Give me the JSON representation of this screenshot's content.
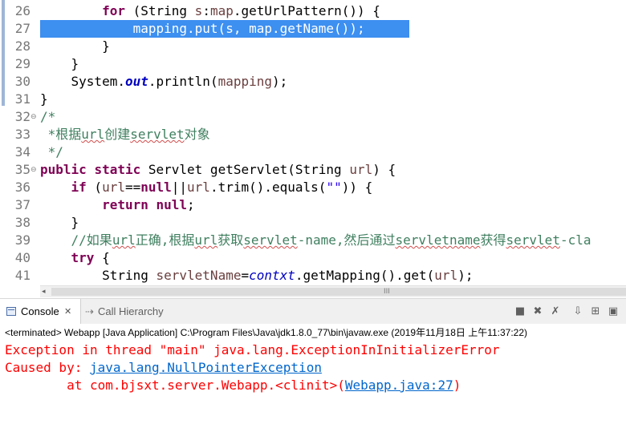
{
  "editor": {
    "lines": [
      {
        "num": "26",
        "fold": false,
        "highlight": false,
        "selected": false,
        "tokens": [
          {
            "t": "        ",
            "c": ""
          },
          {
            "t": "for",
            "c": "kw"
          },
          {
            "t": " (String ",
            "c": ""
          },
          {
            "t": "s",
            "c": "var"
          },
          {
            "t": ":",
            "c": ""
          },
          {
            "t": "map",
            "c": "var"
          },
          {
            "t": ".getUrlPattern()) {",
            "c": ""
          }
        ]
      },
      {
        "num": "27",
        "fold": false,
        "highlight": true,
        "selected": true,
        "tokens": [
          {
            "t": "            mapping.put(s, map.getName());",
            "c": "sel"
          }
        ]
      },
      {
        "num": "28",
        "fold": false,
        "highlight": false,
        "selected": false,
        "tokens": [
          {
            "t": "        }",
            "c": ""
          }
        ]
      },
      {
        "num": "29",
        "fold": false,
        "highlight": false,
        "selected": false,
        "tokens": [
          {
            "t": "    }",
            "c": ""
          }
        ]
      },
      {
        "num": "30",
        "fold": false,
        "highlight": false,
        "selected": false,
        "tokens": [
          {
            "t": "    System.",
            "c": ""
          },
          {
            "t": "out",
            "c": "fld"
          },
          {
            "t": ".println(",
            "c": ""
          },
          {
            "t": "mapping",
            "c": "var"
          },
          {
            "t": ");",
            "c": ""
          }
        ]
      },
      {
        "num": "31",
        "fold": false,
        "highlight": false,
        "selected": false,
        "tokens": [
          {
            "t": "}",
            "c": ""
          }
        ]
      },
      {
        "num": "32",
        "fold": true,
        "highlight": false,
        "selected": false,
        "tokens": [
          {
            "t": "/*",
            "c": "cm"
          }
        ]
      },
      {
        "num": "33",
        "fold": false,
        "highlight": false,
        "selected": false,
        "tokens": [
          {
            "t": " *根据",
            "c": "cm"
          },
          {
            "t": "url",
            "c": "cm sq"
          },
          {
            "t": "创建",
            "c": "cm"
          },
          {
            "t": "servlet",
            "c": "cm sq"
          },
          {
            "t": "对象",
            "c": "cm"
          }
        ]
      },
      {
        "num": "34",
        "fold": false,
        "highlight": false,
        "selected": false,
        "tokens": [
          {
            "t": " */",
            "c": "cm"
          }
        ]
      },
      {
        "num": "35",
        "fold": true,
        "highlight": false,
        "selected": false,
        "tokens": [
          {
            "t": "public",
            "c": "kw"
          },
          {
            "t": " ",
            "c": ""
          },
          {
            "t": "static",
            "c": "kw"
          },
          {
            "t": " Servlet getServlet(String ",
            "c": ""
          },
          {
            "t": "url",
            "c": "var"
          },
          {
            "t": ") {",
            "c": ""
          }
        ]
      },
      {
        "num": "36",
        "fold": false,
        "highlight": false,
        "selected": false,
        "tokens": [
          {
            "t": "    ",
            "c": ""
          },
          {
            "t": "if",
            "c": "kw"
          },
          {
            "t": " (",
            "c": ""
          },
          {
            "t": "url",
            "c": "var"
          },
          {
            "t": "==",
            "c": ""
          },
          {
            "t": "null",
            "c": "kw"
          },
          {
            "t": "||",
            "c": ""
          },
          {
            "t": "url",
            "c": "var"
          },
          {
            "t": ".trim().equals(",
            "c": ""
          },
          {
            "t": "\"\"",
            "c": "str"
          },
          {
            "t": ")) {",
            "c": ""
          }
        ]
      },
      {
        "num": "37",
        "fold": false,
        "highlight": false,
        "selected": false,
        "tokens": [
          {
            "t": "        ",
            "c": ""
          },
          {
            "t": "return",
            "c": "kw"
          },
          {
            "t": " ",
            "c": ""
          },
          {
            "t": "null",
            "c": "kw"
          },
          {
            "t": ";",
            "c": ""
          }
        ]
      },
      {
        "num": "38",
        "fold": false,
        "highlight": false,
        "selected": false,
        "tokens": [
          {
            "t": "    }",
            "c": ""
          }
        ]
      },
      {
        "num": "39",
        "fold": false,
        "highlight": false,
        "selected": false,
        "tokens": [
          {
            "t": "    //如果",
            "c": "cm"
          },
          {
            "t": "url",
            "c": "cm sq"
          },
          {
            "t": "正确,根据",
            "c": "cm"
          },
          {
            "t": "url",
            "c": "cm sq"
          },
          {
            "t": "获取",
            "c": "cm"
          },
          {
            "t": "servlet",
            "c": "cm sq"
          },
          {
            "t": "-name,然后通过",
            "c": "cm"
          },
          {
            "t": "servletname",
            "c": "cm sq"
          },
          {
            "t": "获得",
            "c": "cm"
          },
          {
            "t": "servlet",
            "c": "cm sq"
          },
          {
            "t": "-cla",
            "c": "cm"
          }
        ]
      },
      {
        "num": "40",
        "fold": false,
        "highlight": false,
        "selected": false,
        "tokens": [
          {
            "t": "    ",
            "c": ""
          },
          {
            "t": "try",
            "c": "kw"
          },
          {
            "t": " {",
            "c": ""
          }
        ]
      },
      {
        "num": "41",
        "fold": false,
        "highlight": false,
        "selected": false,
        "tokens": [
          {
            "t": "        String ",
            "c": ""
          },
          {
            "t": "servletName",
            "c": "var"
          },
          {
            "t": "=",
            "c": ""
          },
          {
            "t": "contxt",
            "c": "fldi"
          },
          {
            "t": ".getMapping().get(",
            "c": ""
          },
          {
            "t": "url",
            "c": "var"
          },
          {
            "t": ");",
            "c": ""
          }
        ]
      }
    ]
  },
  "scrollbar": {
    "left_arrow": "◂",
    "grip": "III"
  },
  "console": {
    "tabs": {
      "console_label": "Console",
      "console_close": "✕",
      "hierarchy_label": "Call Hierarchy",
      "hierarchy_icon": "⇢"
    },
    "toolbar_icons": [
      "terminate-icon",
      "remove-launch-icon",
      "remove-all-icon",
      "scroll-lock-icon",
      "pin-icon",
      "open-console-icon"
    ],
    "status": "<terminated> Webapp [Java Application] C:\\Program Files\\Java\\jdk1.8.0_77\\bin\\javaw.exe (2019年11月18日 上午11:37:22)",
    "output": {
      "line1": "Exception in thread \"main\" java.lang.ExceptionInInitializerError",
      "line2_prefix": "Caused by: ",
      "line2_link": "java.lang.NullPointerException",
      "line3_prefix": "        at com.bjsxt.server.Webapp.<clinit>(",
      "line3_link": "Webapp.java:27",
      "line3_suffix": ")"
    }
  }
}
